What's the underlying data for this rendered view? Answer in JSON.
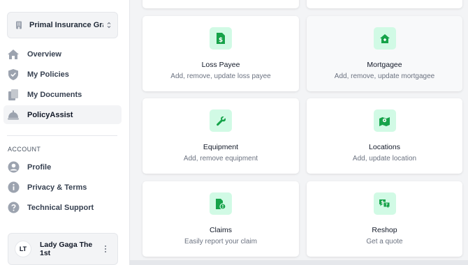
{
  "sidebar": {
    "org_name": "Primal Insurance Grace…",
    "nav": [
      {
        "label": "Overview",
        "icon": "home-icon"
      },
      {
        "label": "My Policies",
        "icon": "shield-check-icon"
      },
      {
        "label": "My Documents",
        "icon": "documents-icon"
      },
      {
        "label": "PolicyAssist",
        "icon": "service-bell-icon",
        "active": true
      }
    ],
    "section_label": "ACCOUNT",
    "account_nav": [
      {
        "label": "Profile",
        "icon": "user-circle-icon"
      },
      {
        "label": "Privacy & Terms",
        "icon": "info-circle-icon"
      },
      {
        "label": "Technical Support",
        "icon": "question-circle-icon"
      }
    ],
    "user": {
      "initials": "LT",
      "name": "Lady Gaga The 1st"
    }
  },
  "cards": [
    {
      "title": "Loss Payee",
      "subtitle": "Add, remove, update loss payee",
      "icon": "dollar-document-icon"
    },
    {
      "title": "Mortgagee",
      "subtitle": "Add, remove, update mortgagee",
      "icon": "house-icon"
    },
    {
      "title": "Equipment",
      "subtitle": "Add, remove equipment",
      "icon": "wrench-icon"
    },
    {
      "title": "Locations",
      "subtitle": "Add, update location",
      "icon": "map-pin-icon"
    },
    {
      "title": "Claims",
      "subtitle": "Easily report your claim",
      "icon": "claim-document-icon"
    },
    {
      "title": "Reshop",
      "subtitle": "Get a quote",
      "icon": "chat-dollar-icon"
    }
  ],
  "colors": {
    "accent": "#16a34a",
    "icon_bg": "#d1fae5",
    "sidebar_icon": "#9ca3af"
  }
}
